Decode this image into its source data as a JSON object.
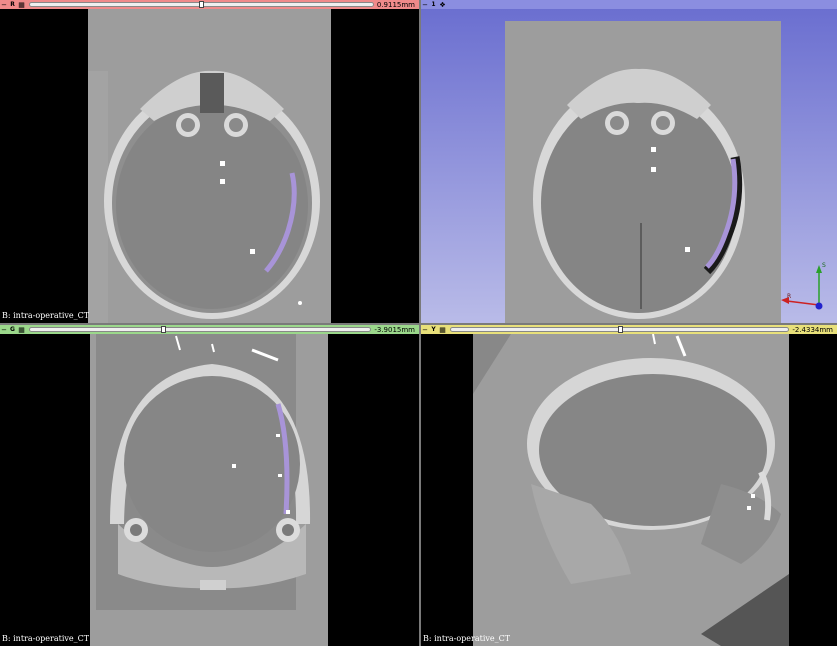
{
  "views": {
    "red": {
      "tag": "R",
      "value": "0.9115mm",
      "slider_fraction": 0.5,
      "bar_color": "#f08a8a",
      "corner_text": "B: intra-operative_CT"
    },
    "threed": {
      "tag": "1",
      "bar_color": "#8b8ee0",
      "axis_labels": {
        "s": "S",
        "r": "R"
      }
    },
    "green": {
      "tag": "G",
      "value": "-3.9015mm",
      "slider_fraction": 0.39,
      "bar_color": "#9bd88b",
      "corner_text": "B: intra-operative_CT"
    },
    "yellow": {
      "tag": "Y",
      "value": "-2.4334mm",
      "slider_fraction": 0.5,
      "bar_color": "#e8e07a",
      "corner_text": "B: intra-operative_CT"
    }
  },
  "icons": {
    "pin": "pin-icon",
    "link": "link-icon",
    "axes": "orientation-axes-icon"
  },
  "colors": {
    "segmentation": "#a894d8",
    "bone": "#e6e6e6",
    "brain": "#8e8e8e",
    "scan_bg": "#9d9d9d",
    "threed_bg_top": "#6b6fd0",
    "threed_bg_bottom": "#b9bbe8"
  }
}
